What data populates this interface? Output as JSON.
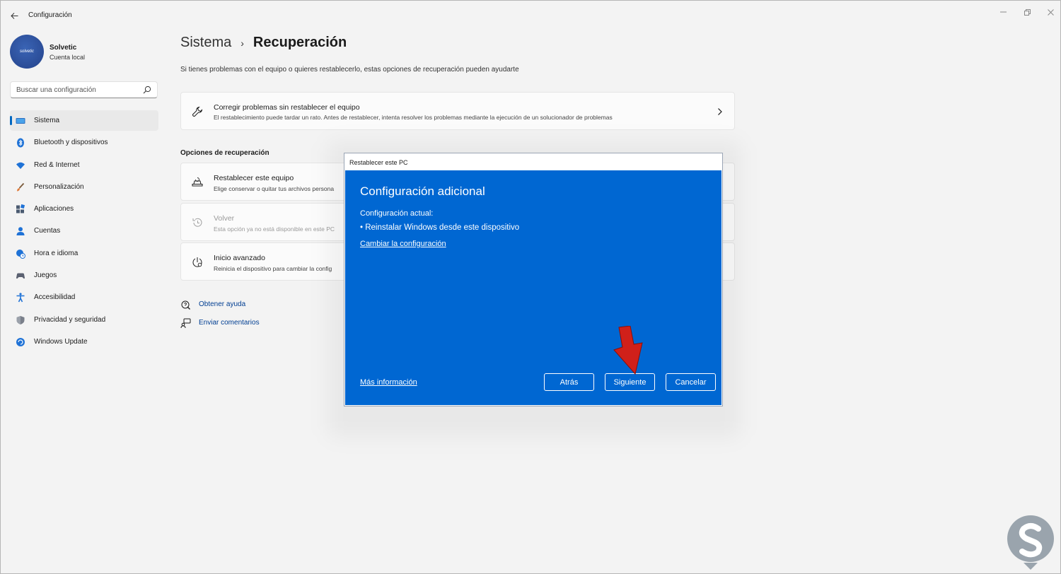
{
  "window": {
    "title": "Configuración"
  },
  "user": {
    "name": "Solvetic",
    "account_type": "Cuenta local",
    "avatar_text": "solvetic"
  },
  "search": {
    "placeholder": "Buscar una configuración"
  },
  "sidebar": {
    "items": [
      {
        "label": "Sistema",
        "icon": "monitor-icon",
        "active": true
      },
      {
        "label": "Bluetooth y dispositivos",
        "icon": "bluetooth-icon"
      },
      {
        "label": "Red & Internet",
        "icon": "wifi-icon"
      },
      {
        "label": "Personalización",
        "icon": "brush-icon"
      },
      {
        "label": "Aplicaciones",
        "icon": "apps-icon"
      },
      {
        "label": "Cuentas",
        "icon": "person-icon"
      },
      {
        "label": "Hora e idioma",
        "icon": "globe-clock-icon"
      },
      {
        "label": "Juegos",
        "icon": "gamepad-icon"
      },
      {
        "label": "Accesibilidad",
        "icon": "accessibility-icon"
      },
      {
        "label": "Privacidad y seguridad",
        "icon": "shield-icon"
      },
      {
        "label": "Windows Update",
        "icon": "update-icon"
      }
    ]
  },
  "main": {
    "breadcrumb": {
      "parent": "Sistema",
      "separator": "›",
      "current": "Recuperación"
    },
    "subtitle": "Si tienes problemas con el equipo o quieres restablecerlo, estas opciones de recuperación pueden ayudarte",
    "fix_card": {
      "title": "Corregir problemas sin restablecer el equipo",
      "description": "El restablecimiento puede tardar un rato. Antes de restablecer, intenta resolver los problemas mediante la ejecución de un solucionador de problemas"
    },
    "section_title": "Opciones de recuperación",
    "options": [
      {
        "title": "Restablecer este equipo",
        "description": "Elige conservar o quitar tus archivos persona"
      },
      {
        "title": "Volver",
        "description": "Esta opción ya no está disponible en este PC"
      },
      {
        "title": "Inicio avanzado",
        "description": "Reinicia el dispositivo para cambiar la config"
      }
    ],
    "help": {
      "get_help": "Obtener ayuda",
      "feedback": "Enviar comentarios"
    }
  },
  "dialog": {
    "title": "Restablecer este PC",
    "heading": "Configuración adicional",
    "current_label": "Configuración actual:",
    "current_item": "• Reinstalar Windows desde este dispositivo",
    "change_link": "Cambiar la configuración",
    "more_info": "Más información",
    "buttons": {
      "back": "Atrás",
      "next": "Siguiente",
      "cancel": "Cancelar"
    }
  },
  "colors": {
    "accent": "#0067c0",
    "dialog_bg": "#0067d2",
    "arrow": "#d0201a",
    "logo": "#9aa4ad"
  }
}
